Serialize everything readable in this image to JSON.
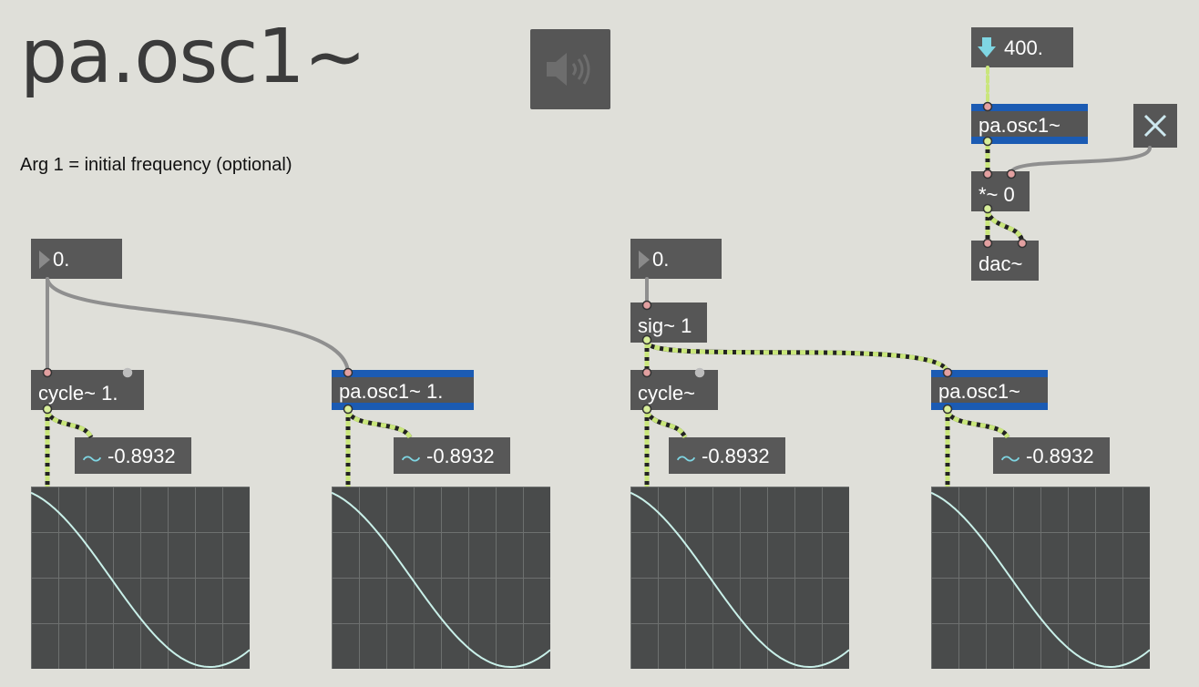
{
  "title": "pa.osc1~",
  "description": "Arg 1 = initial frequency (optional)",
  "icons": {
    "ezdac": "speaker-icon",
    "toggle": "close-x-icon",
    "float_down": "down-arrow-icon",
    "float_right": "right-triangle-icon",
    "signal": "tilde-icon"
  },
  "colors": {
    "background": "#dfdfd9",
    "object": "#565656",
    "pa_object_frame": "#1b5bb3",
    "signal_patchcord": "#c9e67b",
    "control_patchcord": "#9a9a9a",
    "scope_trace": "#c9f0e9"
  },
  "audio_chain": {
    "number_value": "400.",
    "osc_label": "pa.osc1~",
    "mult_label": "*~ 0",
    "dac_label": "dac~"
  },
  "left_group": {
    "number_value": "0.",
    "cycle_label": "cycle~ 1.",
    "osc_label": "pa.osc1~ 1.",
    "cycle_signal_value": "-0.8932",
    "osc_signal_value": "-0.8932"
  },
  "right_group": {
    "number_value": "0.",
    "sig_label": "sig~ 1",
    "cycle_label": "cycle~",
    "osc_label": "pa.osc1~",
    "cycle_signal_value": "-0.8932",
    "osc_signal_value": "-0.8932"
  },
  "scopes": [
    {
      "name": "left-cycle-scope",
      "waveform": "cosine",
      "phase_start": 0.55,
      "phase_span": 0.55
    },
    {
      "name": "left-osc-scope",
      "waveform": "cosine",
      "phase_start": 0.55,
      "phase_span": 0.55
    },
    {
      "name": "right-cycle-scope",
      "waveform": "cosine",
      "phase_start": 0.55,
      "phase_span": 0.55
    },
    {
      "name": "right-osc-scope",
      "waveform": "cosine",
      "phase_start": 0.55,
      "phase_span": 0.55
    }
  ]
}
